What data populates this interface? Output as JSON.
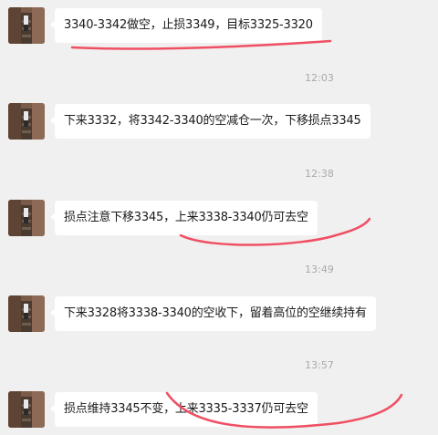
{
  "messages": [
    {
      "text": "3340-3342做空，止损3349，目标3325-3320"
    },
    {
      "text": "下来3332，将3342-3340的空减仓一次，下移损点3345"
    },
    {
      "text": "损点注意下移3345，上来3338-3340仍可去空"
    },
    {
      "text": "下来3328将3338-3340的空收下，留着高位的空继续持有"
    },
    {
      "text": "损点维持3345不变，上来3335-3337仍可去空"
    }
  ],
  "timestamps": [
    "12:03",
    "12:38",
    "13:49",
    "13:57"
  ],
  "colors": {
    "background": "#f0f0f0",
    "bubble": "#ffffff",
    "timestamp_text": "#a9a9a9",
    "annotation": "#f04f63"
  },
  "icons": {
    "avatar": "avatar-photo-icon"
  }
}
